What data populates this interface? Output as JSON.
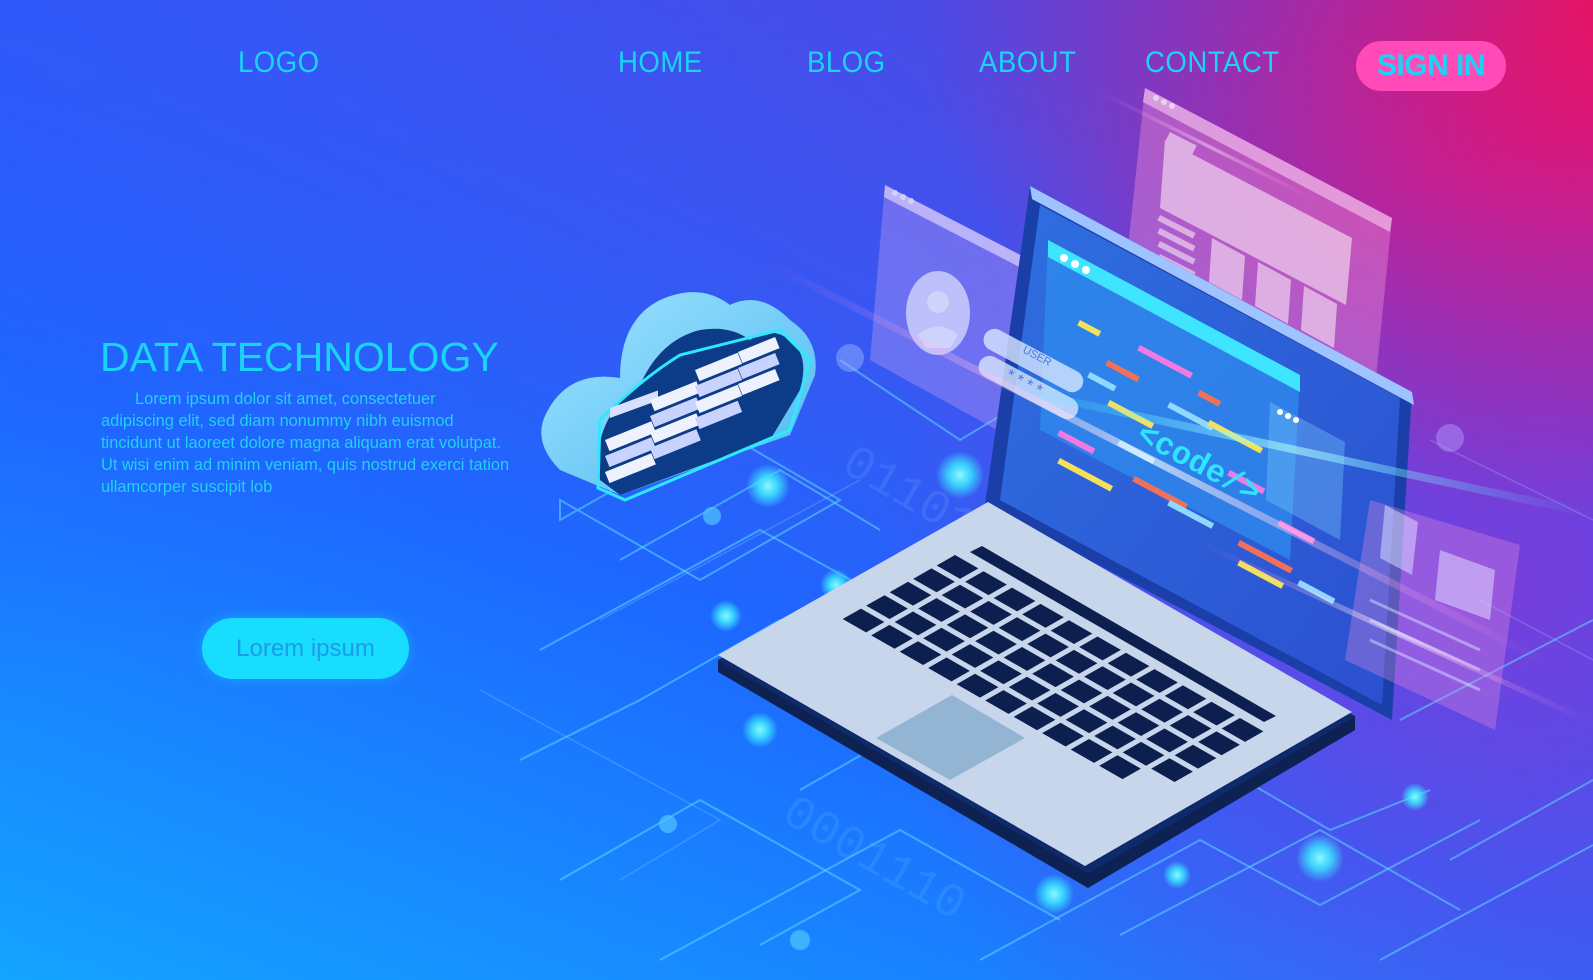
{
  "nav": {
    "logo": "LOGO",
    "items": [
      {
        "label": "HOME"
      },
      {
        "label": "BLOG"
      },
      {
        "label": "ABOUT"
      },
      {
        "label": "CONTACT"
      }
    ],
    "sign_in": "SIGN IN"
  },
  "hero": {
    "title": "DATA TECHNOLOGY",
    "body": "Lorem ipsum dolor sit amet, consectetuer adipiscing elit, sed diam nonummy nibh euismod tincidunt ut laoreet dolore magna aliquam erat volutpat. Ut wisi enim ad minim veniam, quis nostrud exerci tation ullamcorper suscipit lob",
    "cta_label": "Lorem ipsum"
  },
  "illustration": {
    "screen_code_text": "<code/>",
    "login_user_label": "USER",
    "login_password_mask": "* * * *",
    "binary_watermark": "0110101 0001"
  },
  "colors": {
    "accent_cyan": "#19d4f5",
    "signin_bg": "#ff4ab8",
    "cta_bg": "#19ddff",
    "cta_text": "#1c9bea",
    "laptop_deck": "#c8d6ec",
    "keyboard_keys": "#0c1f4f",
    "gradient_top_right": "#ff0a50",
    "gradient_bottom_left": "#14a4ff"
  }
}
